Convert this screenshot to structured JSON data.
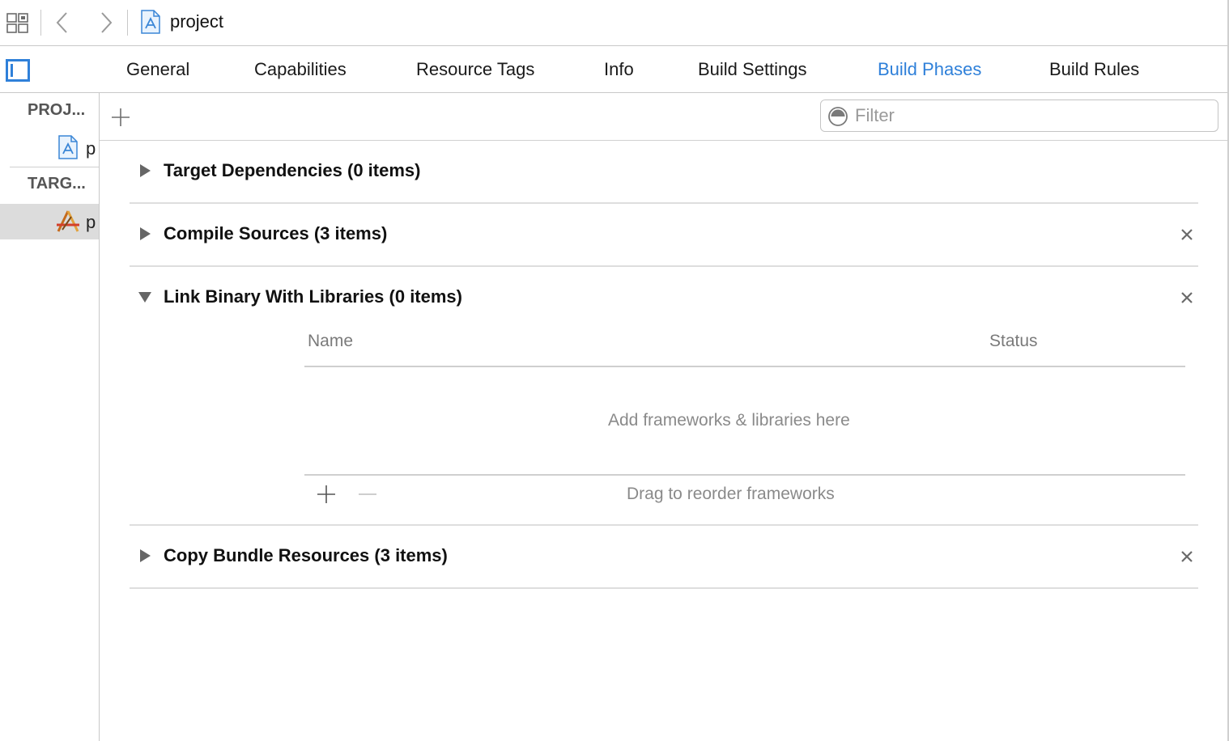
{
  "jumpbar": {
    "breadcrumb_label": "project",
    "icons": [
      "grid-icon",
      "back-arrow-icon",
      "forward-arrow-icon",
      "project-file-icon"
    ]
  },
  "tabs": [
    {
      "label": "General",
      "active": false
    },
    {
      "label": "Capabilities",
      "active": false
    },
    {
      "label": "Resource Tags",
      "active": false
    },
    {
      "label": "Info",
      "active": false
    },
    {
      "label": "Build Settings",
      "active": false
    },
    {
      "label": "Build Phases",
      "active": true
    },
    {
      "label": "Build Rules",
      "active": false
    }
  ],
  "sidebar": {
    "project_header": "PROJ...",
    "project_item": "p",
    "targets_header": "TARG...",
    "target_item": "p"
  },
  "filter": {
    "placeholder": "Filter",
    "value": ""
  },
  "phases": [
    {
      "title": "Target Dependencies (0 items)",
      "expanded": false,
      "removable": false
    },
    {
      "title": "Compile Sources (3 items)",
      "expanded": false,
      "removable": true
    },
    {
      "title": "Link Binary With Libraries (0 items)",
      "expanded": true,
      "removable": true
    },
    {
      "title": "Copy Bundle Resources (3 items)",
      "expanded": false,
      "removable": true
    }
  ],
  "link_table": {
    "col_name": "Name",
    "col_status": "Status",
    "empty_message": "Add frameworks & libraries here",
    "footer_hint": "Drag to reorder frameworks"
  },
  "colors": {
    "accent": "#2f80d9",
    "separator": "#c8c8c8",
    "selection": "#dcdcdc"
  }
}
